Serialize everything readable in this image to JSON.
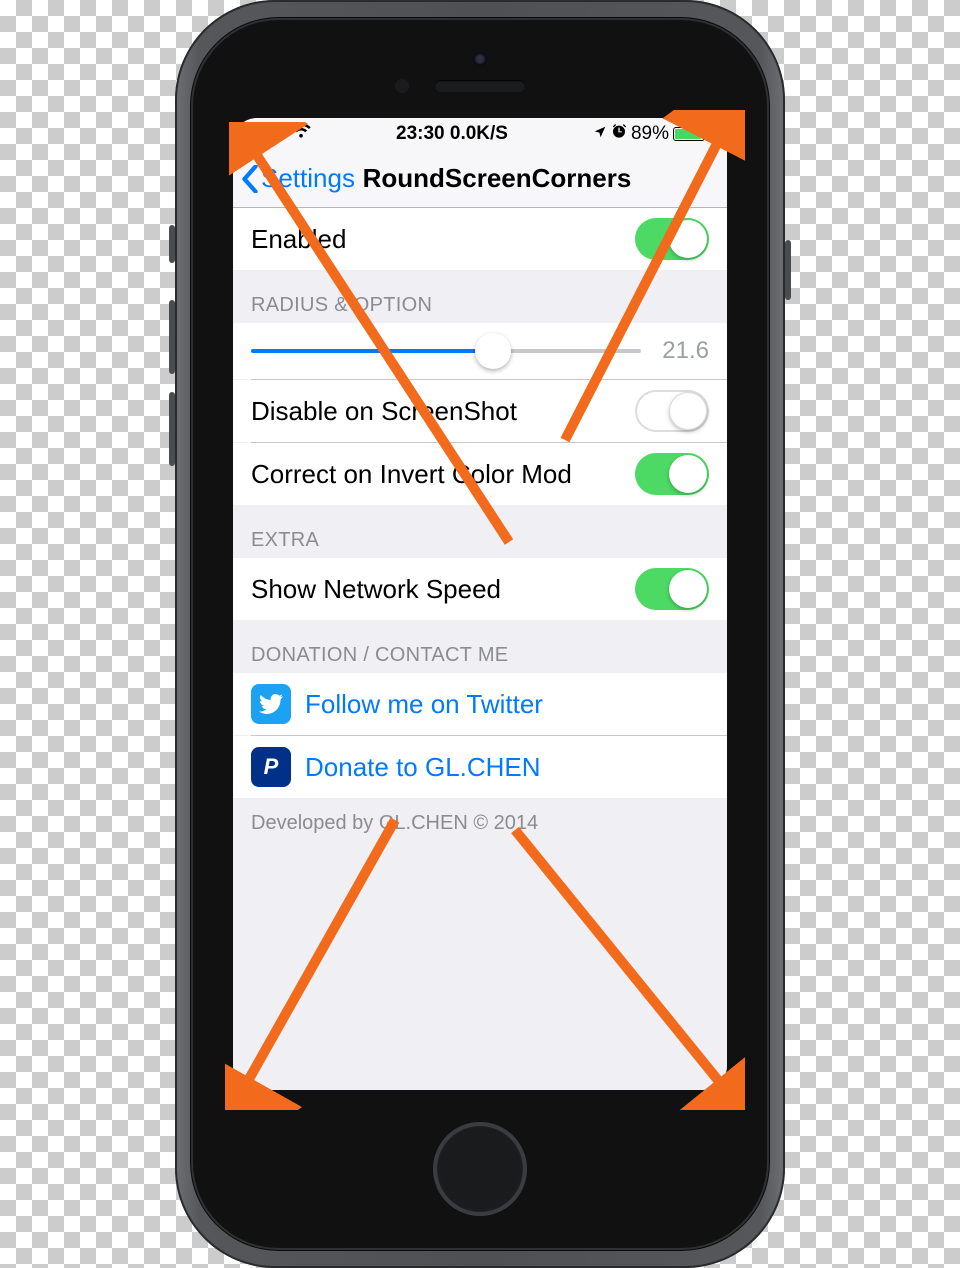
{
  "status": {
    "time_and_speed": "23:30 0.0K/S",
    "battery_pct": "89%"
  },
  "nav": {
    "back": "Settings",
    "title": "RoundScreenCorners"
  },
  "enabled": {
    "label": "Enabled",
    "on": true
  },
  "radius_section": {
    "header": "RADIUS & OPTION",
    "value": "21.6",
    "items": [
      {
        "label": "Disable on ScreenShot",
        "on": false
      },
      {
        "label": "Correct on Invert Color Mod",
        "on": true
      }
    ]
  },
  "extra_section": {
    "header": "EXTRA",
    "items": [
      {
        "label": "Show Network Speed",
        "on": true
      }
    ]
  },
  "donation_section": {
    "header": "DONATION / CONTACT ME",
    "links": [
      {
        "label": "Follow me on Twitter"
      },
      {
        "label": "Donate to GL.CHEN"
      }
    ]
  },
  "footer": "Developed by GL.CHEN © 2014"
}
